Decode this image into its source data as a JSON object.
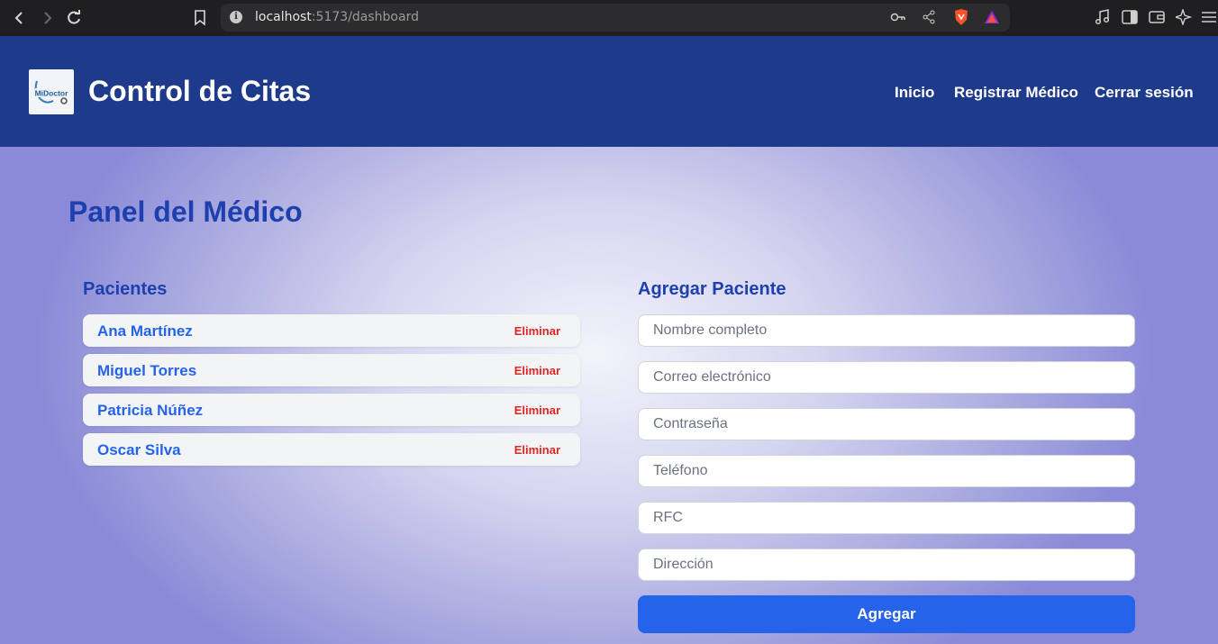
{
  "browser": {
    "url_host": "localhost",
    "url_path": ":5173/dashboard",
    "icons": [
      "back-icon",
      "forward-icon",
      "reload-icon",
      "bookmark-icon",
      "key-icon",
      "share-icon",
      "brave-shield-icon",
      "rewards-icon",
      "media-icon",
      "sidebar-icon",
      "wallet-icon",
      "leo-icon",
      "menu-icon"
    ]
  },
  "header": {
    "logo_text": "MiDoctor",
    "title": "Control de Citas",
    "nav": [
      "Inicio",
      "Registrar Médico",
      "Cerrar sesión"
    ]
  },
  "main": {
    "page_title": "Panel del Médico",
    "patients_title": "Pacientes",
    "delete_label": "Eliminar",
    "patients": [
      "Ana Martínez",
      "Miguel Torres",
      "Patricia Núñez",
      "Oscar Silva"
    ],
    "form_title": "Agregar Paciente",
    "placeholders": [
      "Nombre completo",
      "Correo electrónico",
      "Contraseña",
      "Teléfono",
      "RFC",
      "Dirección"
    ],
    "submit_label": "Agregar"
  },
  "colors": {
    "header_bg": "#1e3a8a",
    "accent": "#2563eb",
    "title": "#1e40af",
    "danger": "#dc2626"
  }
}
